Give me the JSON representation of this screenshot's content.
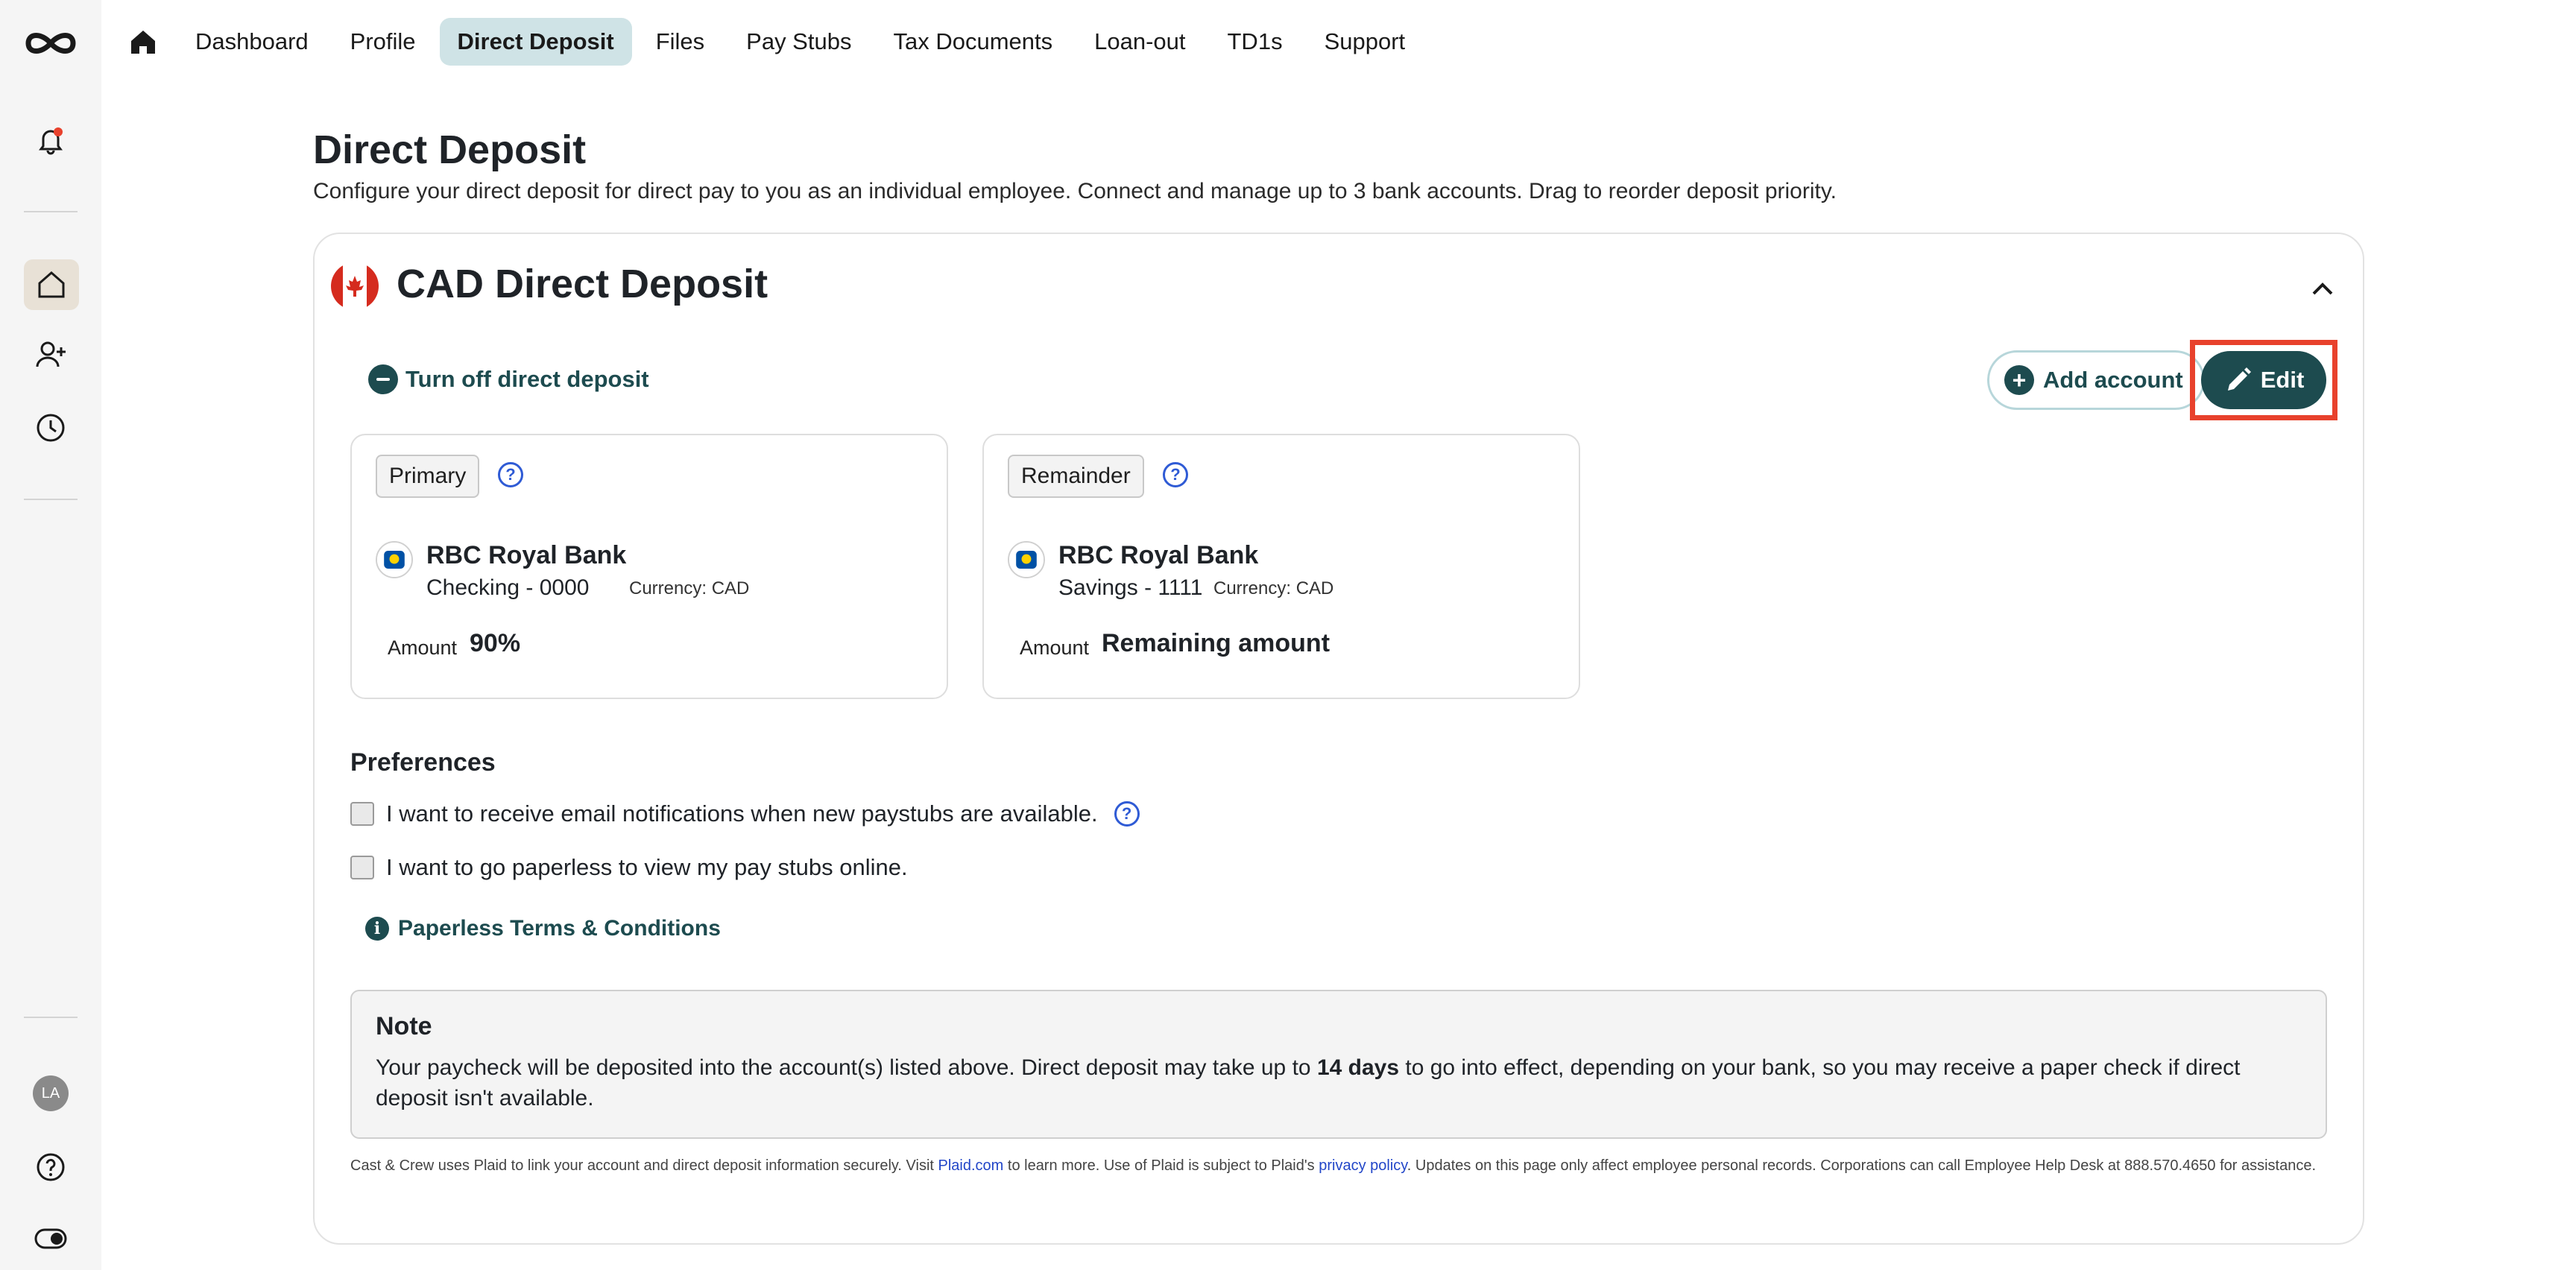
{
  "nav": {
    "items": [
      "Dashboard",
      "Profile",
      "Direct Deposit",
      "Files",
      "Pay Stubs",
      "Tax Documents",
      "Loan-out",
      "TD1s",
      "Support"
    ],
    "active": "Direct Deposit"
  },
  "sidebar": {
    "avatar_initials": "LA"
  },
  "page": {
    "title": "Direct Deposit",
    "subtitle": "Configure your direct deposit for direct pay to you as an individual employee. Connect and manage up to 3 bank accounts. Drag to reorder deposit priority."
  },
  "card": {
    "title": "CAD Direct Deposit",
    "turn_off_label": "Turn off direct deposit",
    "add_account_label": "Add account",
    "edit_label": "Edit"
  },
  "accounts": [
    {
      "priority": "Primary",
      "bank": "RBC Royal Bank",
      "account": "Checking - 0000",
      "currency": "Currency: CAD",
      "amount_label": "Amount",
      "amount": "90%"
    },
    {
      "priority": "Remainder",
      "bank": "RBC Royal Bank",
      "account": "Savings - 1111",
      "currency": "Currency: CAD",
      "amount_label": "Amount",
      "amount": "Remaining amount"
    }
  ],
  "preferences": {
    "title": "Preferences",
    "email_notifications": "I want to receive email notifications when new paystubs are available.",
    "paperless": "I want to go paperless to view my pay stubs online.",
    "terms_link": "Paperless Terms & Conditions"
  },
  "note": {
    "title": "Note",
    "body_before": "Your paycheck will be deposited into the account(s) listed above. Direct deposit may take up to ",
    "body_bold": "14 days",
    "body_after": " to go into effect, depending on your bank, so you may receive a paper check if direct deposit isn't available."
  },
  "footer": {
    "text_1": "Cast & Crew uses Plaid to link your account and direct deposit information securely. Visit ",
    "plaid_link": "Plaid.com",
    "text_2": " to learn more. Use of Plaid is subject to Plaid's ",
    "privacy_link": "privacy policy",
    "text_3": ". Updates on this page only affect employee personal records. Corporations can call Employee Help Desk at 888.570.4650 for assistance."
  },
  "colors": {
    "accent": "#1d4b4f",
    "nav_active_bg": "#cfe3e6",
    "highlight": "#e8412c",
    "link": "#2246c8"
  }
}
